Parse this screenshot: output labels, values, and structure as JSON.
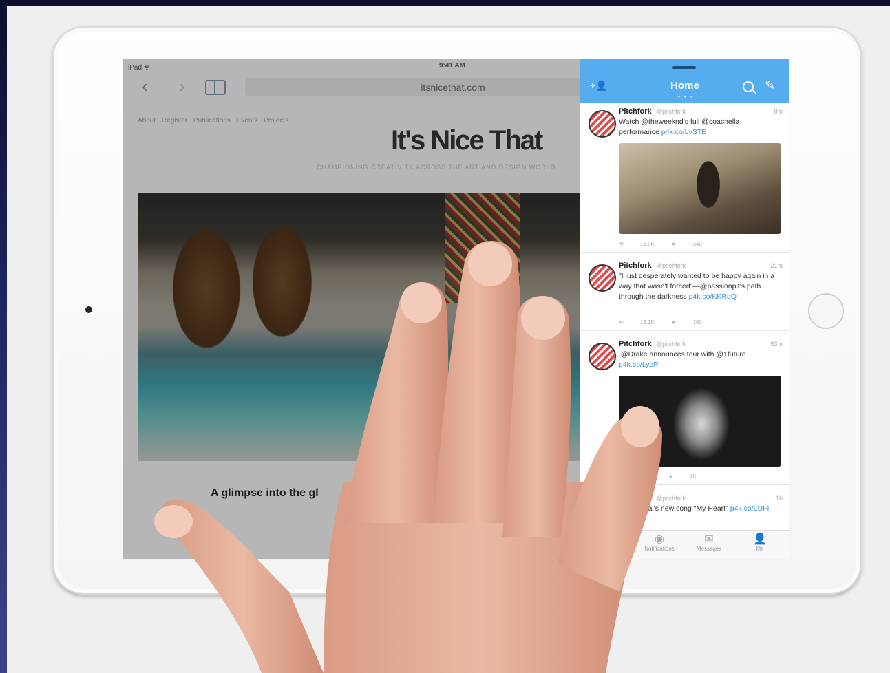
{
  "status_bar": {
    "carrier": "iPad ᯤ",
    "time": "9:41 AM"
  },
  "safari": {
    "address": "itsnicethat.com",
    "site_nav": "About Register Publications Events Projects",
    "site_title": "It's Nice That",
    "tagline": "CHAMPIONING CREATIVITY ACROSS THE ART AND DESIGN WORLD",
    "headline": "A glimpse into the gl"
  },
  "twitter": {
    "header_title": "Home",
    "tweets": [
      {
        "name": "Pitchfork",
        "handle": "@pitchfork",
        "time": "8m",
        "text": "Watch @theweeknd's full @coachella performance ",
        "link": "p4k.co/LvSTE",
        "stats": "⟲ 13.5K ★ 340"
      },
      {
        "name": "Pitchfork",
        "handle": "@pitchfork",
        "time": "21m",
        "text": "\"I just desperately wanted to be happy again in a way that wasn't forced\"—@passionpit's path through the darkness ",
        "link": "p4k.co/KKRdQ",
        "stats": "⟲ 13.1K ★ 180"
      },
      {
        "name": "Pitchfork",
        "handle": "@pitchfork",
        "time": "53m",
        "text": ".@Drake announces tour with @1future ",
        "link": "p4k.co/LydP",
        "stats": "⟲ 9.5K ★ 40"
      },
      {
        "name": "",
        "handle": "@pitchfork",
        "time": "1h",
        "text": "@iluofficial's new song \"My Heart\" ",
        "link": "p4k.co/LUFI",
        "stats": ""
      }
    ],
    "tabs": [
      "Notifications",
      "Messages",
      "Me"
    ]
  }
}
